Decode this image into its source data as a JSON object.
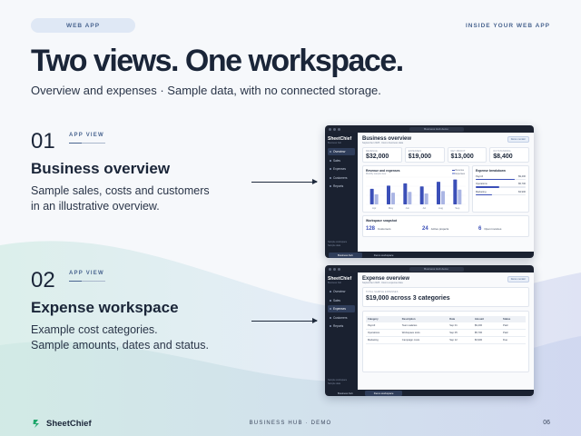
{
  "header": {
    "pill": "WEB APP",
    "kicker": "INSIDE YOUR WEB APP",
    "headline": "Two views. One workspace.",
    "subheadline": "Overview and expenses · Sample data, with no connected storage."
  },
  "views": [
    {
      "number": "01",
      "tag": "APP VIEW",
      "title": "Business overview",
      "desc_line1": "Sample sales, costs and customers",
      "desc_line2": "in an illustrative overview."
    },
    {
      "number": "02",
      "tag": "APP VIEW",
      "title": "Expense workspace",
      "desc_line1": "Example cost categories.",
      "desc_line2": "Sample amounts, dates and status."
    }
  ],
  "app": {
    "url": "Business Hub demo",
    "logo": "SheetChief",
    "logo_sub": "Business hub",
    "nav": [
      "Overview",
      "Sales",
      "Expenses",
      "Customers",
      "Reports"
    ],
    "sidebar_footer_line1": "Sample workspace",
    "sidebar_footer_line2": "Sample data",
    "tabs": [
      "Business hub",
      "Demo workspace"
    ]
  },
  "overview": {
    "title": "Business overview",
    "subtitle": "September 2025 · Demo business data",
    "chip": "Demo monitor",
    "kpis": [
      {
        "label": "REVENUE",
        "value": "$32,000"
      },
      {
        "label": "EXPENSES",
        "value": "$19,000"
      },
      {
        "label": "NET PROFIT",
        "value": "$13,000"
      },
      {
        "label": "OUTSTANDING",
        "value": "$8,400"
      }
    ],
    "chart": {
      "title": "Revenue and expenses",
      "subtitle": "Monthly sample view",
      "legend": [
        "Revenue",
        "Expenses"
      ],
      "months": [
        "Apr",
        "May",
        "Jun",
        "Jul",
        "Aug",
        "Sep"
      ],
      "revenue": [
        20,
        24,
        27,
        23,
        29,
        32
      ],
      "expenses": [
        13,
        15,
        16,
        14,
        17,
        19
      ],
      "color_revenue": "#3b4fb8",
      "color_expenses": "#aab5e4"
    },
    "breakdown": {
      "title": "Expense breakdown",
      "items": [
        {
          "label": "Payroll",
          "value": "$9,400",
          "fill": 0.78
        },
        {
          "label": "Operations",
          "value": "$5,700",
          "fill": 0.48
        },
        {
          "label": "Marketing",
          "value": "$3,900",
          "fill": 0.32
        }
      ]
    },
    "snapshot": {
      "title": "Workspace snapshot",
      "items": [
        {
          "value": "128",
          "label": "Customers"
        },
        {
          "value": "24",
          "label": "Active projects"
        },
        {
          "value": "6",
          "label": "Open invoices"
        }
      ]
    }
  },
  "expense": {
    "title": "Expense overview",
    "subtitle": "September 2025 · Demo expense data",
    "chip": "Demo monitor",
    "total_label": "TOTAL SAMPLE EXPENSES",
    "total_value": "$19,000 across 3 categories",
    "columns": [
      "Category",
      "Description",
      "Date",
      "Amount",
      "Status"
    ],
    "rows": [
      [
        "Payroll",
        "Team salaries",
        "Sep 01",
        "$9,400",
        "Paid"
      ],
      [
        "Operations",
        "Workspace tools",
        "Sep 05",
        "$5,700",
        "Paid"
      ],
      [
        "Marketing",
        "Campaign costs",
        "Sep 12",
        "$3,900",
        "Due"
      ]
    ]
  },
  "footer": {
    "brand": "SheetChief",
    "center": "BUSINESS HUB · DEMO",
    "page": "06"
  },
  "colors": {
    "accent": "#3b4fb8",
    "dark": "#1a2538",
    "sidebar": "#1a2130"
  }
}
